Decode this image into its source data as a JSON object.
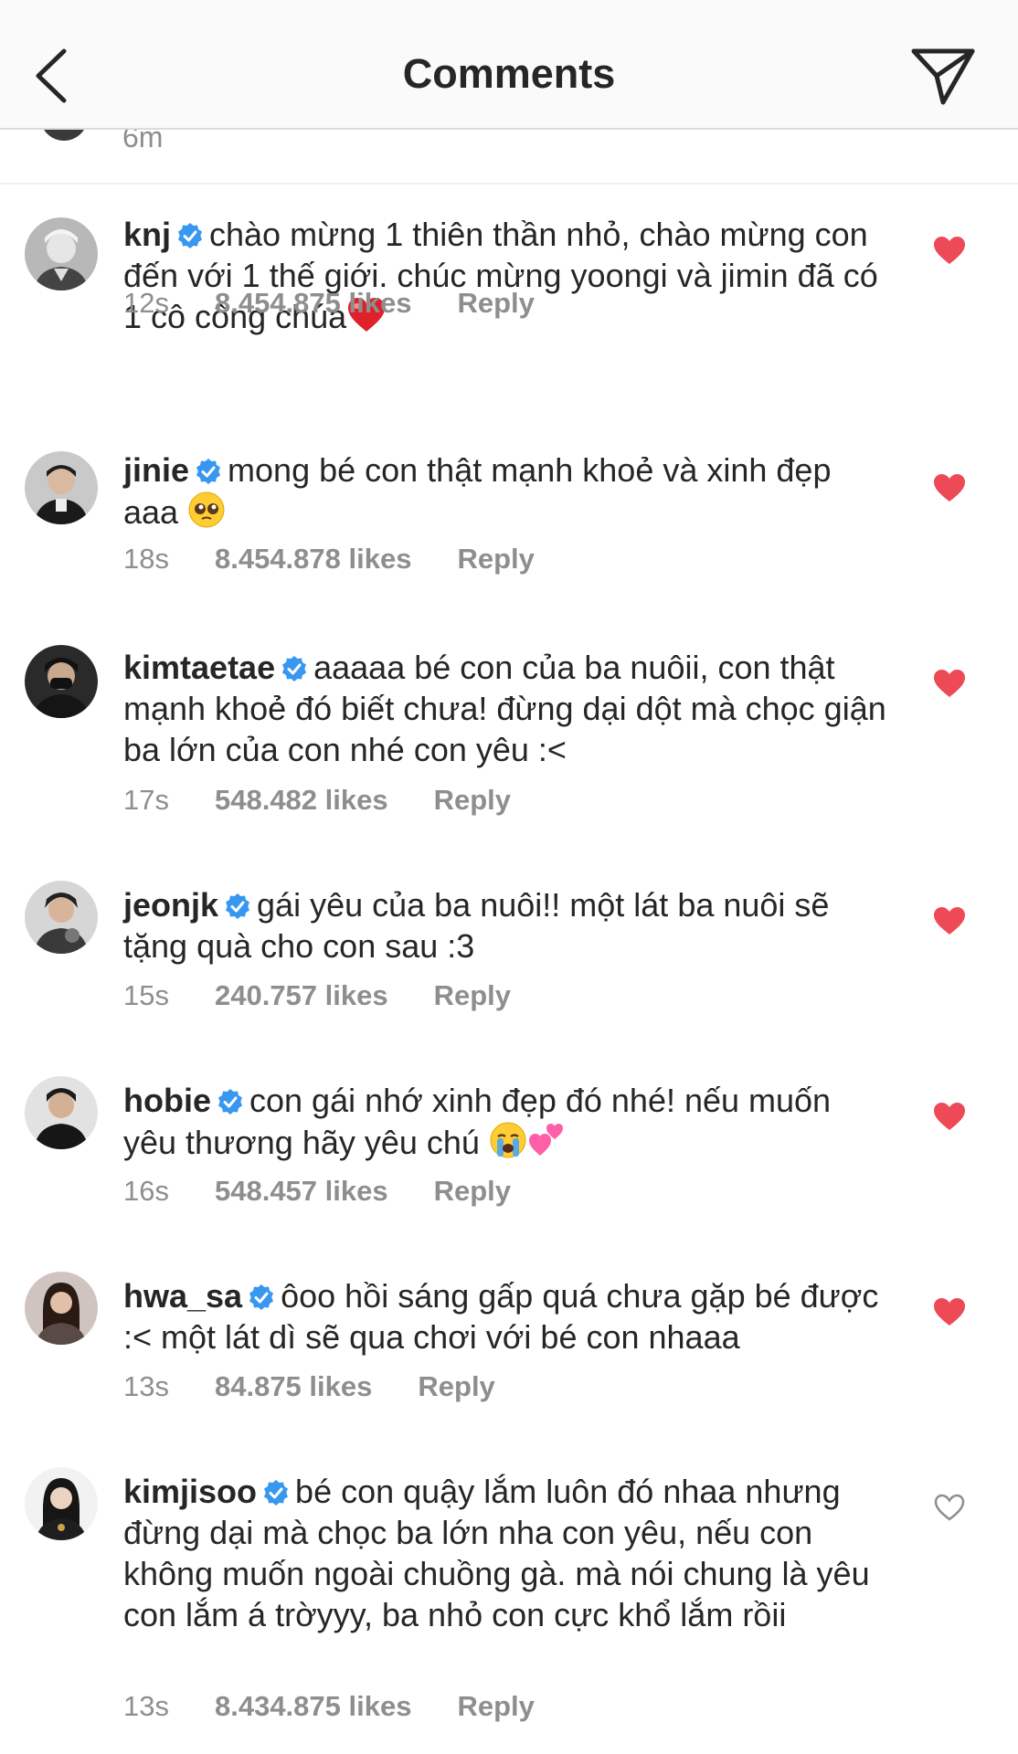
{
  "header": {
    "title": "Comments",
    "back_icon": "chevron-left-icon",
    "share_icon": "paper-plane-icon"
  },
  "previous_comment": {
    "time": "6m"
  },
  "colors": {
    "text": "#262626",
    "meta": "#8e8e8e",
    "heart_liked": "#ed4956",
    "verified": "#3897f0"
  },
  "comments": [
    {
      "username": "knj",
      "text": "chào mừng 1 thiên thần nhỏ, chào mừng con đến với 1 thế giới. chúc mừng yoongi và jimin đã có 1 cô công chúa",
      "emoji": "red-heart-emoji",
      "time": "12s",
      "likes": "8.454.875 likes",
      "reply": "Reply",
      "liked": true
    },
    {
      "username": "jinie",
      "text": "mong bé con thật mạnh khoẻ và xinh đẹp aaa",
      "emoji": "pleading-face-emoji",
      "time": "18s",
      "likes": "8.454.878 likes",
      "reply": "Reply",
      "liked": true
    },
    {
      "username": "kimtaetae",
      "text": "aaaaa bé con của ba nuôii, con thật mạnh khoẻ đó biết chưa! đừng dại dột mà chọc giận ba lớn của con nhé con yêu :<",
      "time": "17s",
      "likes": "548.482 likes",
      "reply": "Reply",
      "liked": true
    },
    {
      "username": "jeonjk",
      "text": "gái yêu của ba nuôi!! một lát ba nuôi sẽ tặng quà cho con sau :3",
      "time": "15s",
      "likes": "240.757 likes",
      "reply": "Reply",
      "liked": true
    },
    {
      "username": "hobie",
      "text": "con gái nhớ xinh đẹp đó nhé! nếu muốn yêu thương hãy yêu chú",
      "emoji": "crying-face-two-hearts-emoji",
      "time": "16s",
      "likes": "548.457 likes",
      "reply": "Reply",
      "liked": true
    },
    {
      "username": "hwa_sa",
      "text": "ôoo hồi sáng gấp quá chưa gặp bé được :< một lát dì sẽ qua chơi với bé con nhaaa",
      "time": "13s",
      "likes": "84.875 likes",
      "reply": "Reply",
      "liked": true
    },
    {
      "username": "kimjisoo",
      "text": "bé con quậy lắm luôn đó nhaa nhưng đừng dại mà chọc ba lớn nha con yêu, nếu con không muốn ngoài chuồng gà. mà nói chung là yêu con lắm á trờyyy, ba nhỏ con cực khổ lắm rồii",
      "time": "13s",
      "likes": "8.434.875 likes",
      "reply": "Reply",
      "liked": false
    }
  ]
}
